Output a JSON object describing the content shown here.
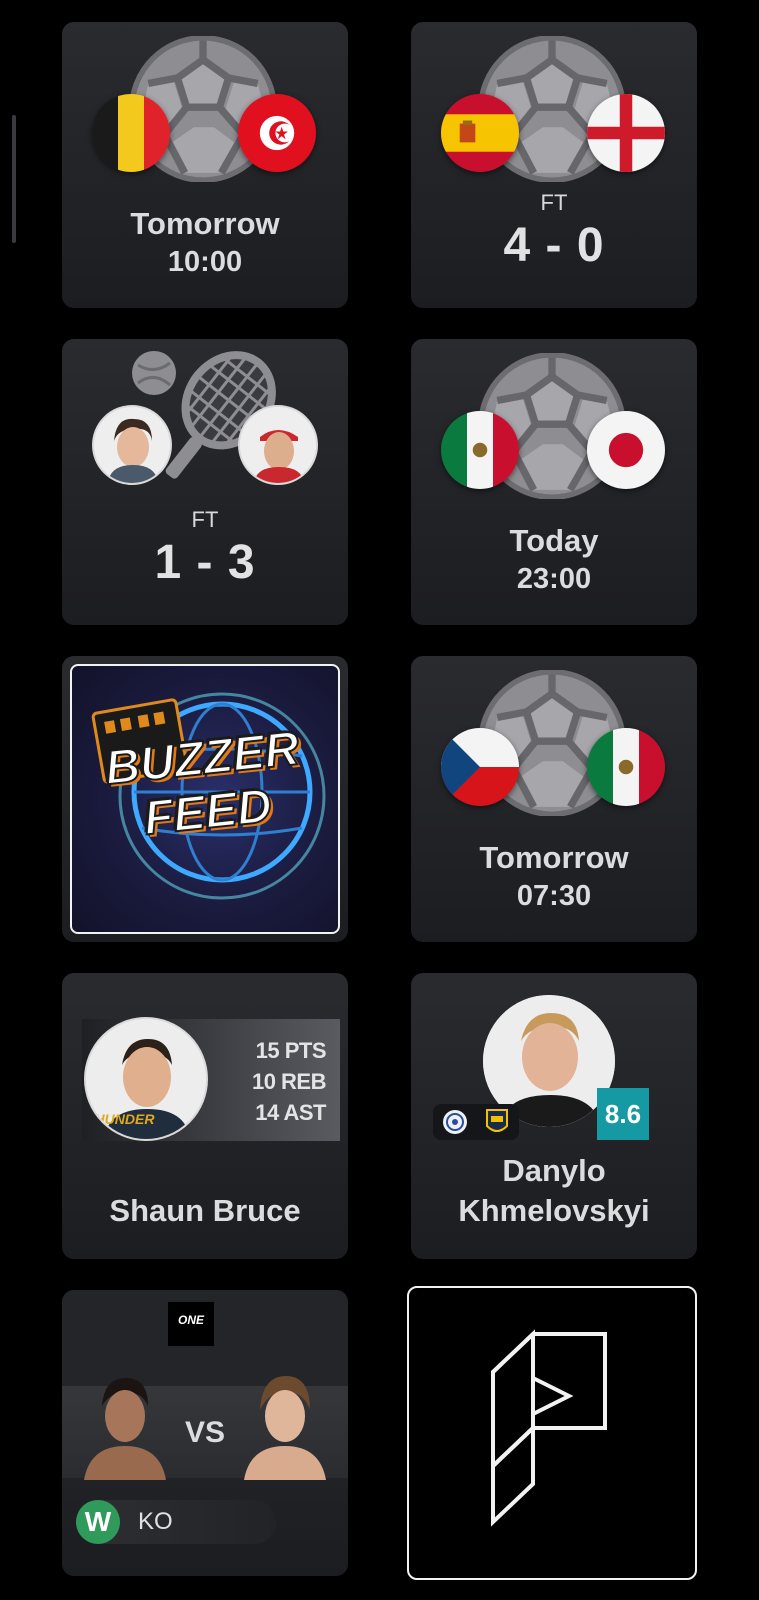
{
  "cards": {
    "bel_tun": {
      "line1": "Tomorrow",
      "line2": "10:00",
      "flag_left": "belgium-flag",
      "flag_right": "tunisia-flag",
      "sport_icon": "soccer-ball-icon"
    },
    "esp_eng": {
      "status": "FT",
      "score": "4 - 0",
      "flag_left": "spain-flag",
      "flag_right": "england-flag",
      "sport_icon": "soccer-ball-icon"
    },
    "tennis": {
      "status": "FT",
      "score": "1 - 3",
      "sport_icon": "tennis-racket-icon"
    },
    "mex_jpn": {
      "line1": "Today",
      "line2": "23:00",
      "flag_left": "mexico-flag",
      "flag_right": "japan-flag",
      "sport_icon": "soccer-ball-icon"
    },
    "buzzer": {
      "logo_line1": "BUZZER",
      "logo_line2": "FEED"
    },
    "cze_mex": {
      "line1": "Tomorrow",
      "line2": "07:30",
      "flag_left": "czech-republic-flag",
      "flag_right": "mexico-flag",
      "sport_icon": "soccer-ball-icon"
    },
    "shaun": {
      "name": "Shaun Bruce",
      "stats": [
        "15 PTS",
        "10 REB",
        "14 AST"
      ],
      "team_text": "THUNDER"
    },
    "danylo": {
      "name_line1": "Danylo",
      "name_line2": "Khmelovskyi",
      "rating": "8.6"
    },
    "fight": {
      "promo": "ONE",
      "vs": "VS",
      "badge": "W",
      "method": "KO"
    },
    "brand": {
      "icon": "p-logo-icon"
    }
  },
  "colors": {
    "background": "#000000",
    "card": "#232428",
    "rating": "#159aa4",
    "win": "#2f9a5a"
  }
}
